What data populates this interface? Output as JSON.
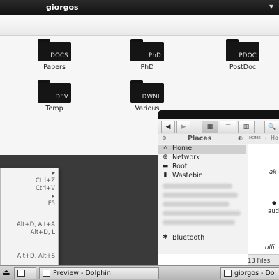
{
  "file_manager": {
    "title": "giorgos",
    "folders": [
      {
        "tag": "DOCS",
        "label": "Papers"
      },
      {
        "tag": "PhD",
        "label": "PhD"
      },
      {
        "tag": "PDOC",
        "label": "PostDoc"
      },
      {
        "tag": "DEV",
        "label": "Temp"
      },
      {
        "tag": "DWNL",
        "label": "Various"
      }
    ]
  },
  "context_menu": {
    "items": [
      "▸",
      "Ctrl+Z",
      "Ctrl+V",
      "▸",
      "F5",
      "Alt+D, Alt+A",
      "Alt+D, L",
      "Alt+D, Alt+S"
    ]
  },
  "dolphin": {
    "view_buttons": [
      "◀",
      "▶",
      "▦",
      "☰",
      "▥",
      "🔍"
    ],
    "places_title": "Places",
    "breadcrumb": "HOME",
    "breadcrumb_next": "Ho",
    "places": [
      {
        "icon": "home-icon",
        "label": "Home"
      },
      {
        "icon": "network-icon",
        "label": "Network"
      },
      {
        "icon": "folder-icon",
        "label": "Root"
      },
      {
        "icon": "trash-icon",
        "label": "Wastebin"
      },
      {
        "icon": "bluetooth-icon",
        "label": "Bluetooth"
      }
    ],
    "content_items": [
      "ak",
      "aud",
      "offi"
    ],
    "status": "13 Files"
  },
  "taskbar": {
    "items": [
      "Preview - Dolphin",
      "giorgos - Do"
    ]
  }
}
